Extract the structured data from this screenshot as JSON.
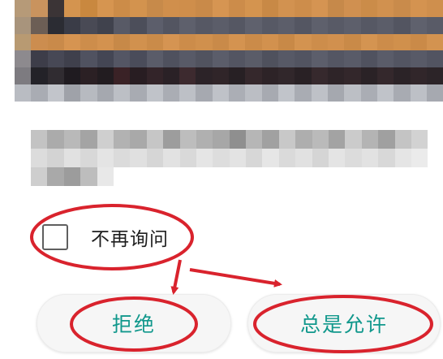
{
  "dialog": {
    "checkbox": {
      "label": "不再询问",
      "checked": false
    },
    "buttons": {
      "deny": "拒绝",
      "allow": "总是允许"
    }
  },
  "colors": {
    "button_text": "#11988c",
    "annotation": "#d9232d",
    "button_bg": "#f6f6f6"
  },
  "icons": [
    "checkbox-icon",
    "arrow-icon"
  ]
}
